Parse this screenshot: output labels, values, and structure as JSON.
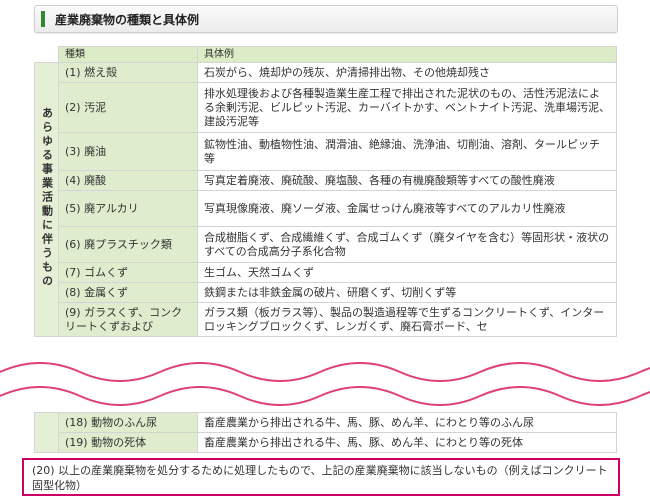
{
  "heading": {
    "title": "産業廃棄物の種類と具体例"
  },
  "table": {
    "col_kind": "種類",
    "col_example": "具体例",
    "group_label": "あらゆる事業活動に伴うもの",
    "rows": [
      {
        "kind": "(1) 燃え殻",
        "example": "石炭がら、焼却炉の残灰、炉清掃排出物、その他焼却残さ"
      },
      {
        "kind": "(2) 汚泥",
        "example": "排水処理後および各種製造業生産工程で排出された泥状のもの、活性汚泥法による余剰汚泥、ビルピット汚泥、カーバイトかす、ベントナイト汚泥、洗車場汚泥、建設汚泥等"
      },
      {
        "kind": "(3) 廃油",
        "example": "鉱物性油、動植物性油、潤滑油、絶縁油、洗浄油、切削油、溶剤、タールピッチ等"
      },
      {
        "kind": "(4) 廃酸",
        "example": "写真定着廃液、廃硫酸、廃塩酸、各種の有機廃酸類等すべての酸性廃液"
      },
      {
        "kind": "(5) 廃アルカリ",
        "example": "写真現像廃液、廃ソーダ液、金属せっけん廃液等すべてのアルカリ性廃液"
      },
      {
        "kind": "(6) 廃プラスチック類",
        "example": "合成樹脂くず、合成繊維くず、合成ゴムくず（廃タイヤを含む）等固形状・液状のすべての合成高分子系化合物"
      },
      {
        "kind": "(7) ゴムくず",
        "example": "生ゴム、天然ゴムくず"
      },
      {
        "kind": "(8) 金属くず",
        "example": "鉄鋼または非鉄金属の破片、研磨くず、切削くず等"
      },
      {
        "kind": "(9) ガラスくず、コンクリートくずおよび",
        "example": "ガラス類（板ガラス等）、製品の製造過程等で生ずるコンクリートくず、インターロッキングブロックくず、レンガくず、廃石膏ボード、セ"
      }
    ],
    "rows_bottom": [
      {
        "kind": "(18) 動物のふん尿",
        "example": "畜産農業から排出される牛、馬、豚、めん羊、にわとり等のふん尿"
      },
      {
        "kind": "(19) 動物の死体",
        "example": "畜産農業から排出される牛、馬、豚、めん羊、にわとり等の死体"
      }
    ],
    "footer_note": "(20) 以上の産業廃棄物を処分するために処理したもので、上記の産業廃棄物に該当しないもの（例えばコンクリート固型化物）"
  }
}
